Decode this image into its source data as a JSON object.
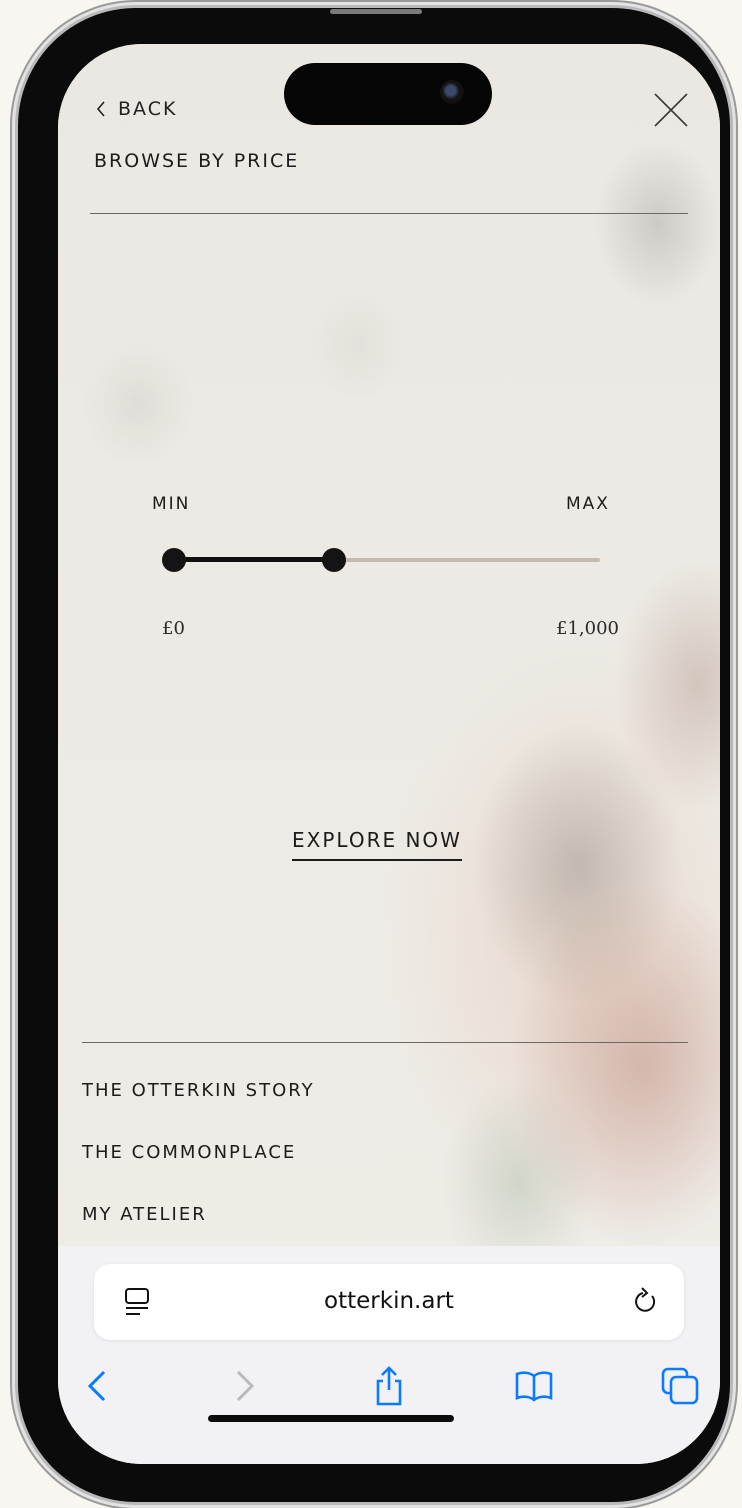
{
  "header": {
    "back_label": "BACK",
    "title": "BROWSE BY PRICE"
  },
  "price_slider": {
    "min_label": "MIN",
    "max_label": "MAX",
    "min_price": "£0",
    "max_price": "£1,000",
    "range_min": 0,
    "range_max": 1000,
    "selected_low": 0,
    "selected_high": 375
  },
  "cta": {
    "explore_label": "EXPLORE NOW"
  },
  "footer_nav": {
    "items": [
      {
        "label": "THE OTTERKIN STORY"
      },
      {
        "label": "THE COMMONPLACE"
      },
      {
        "label": "MY ATELIER"
      }
    ]
  },
  "browser": {
    "url": "otterkin.art"
  },
  "icons": {
    "back": "chevron-left-icon",
    "close": "close-icon",
    "page_settings": "page-settings-icon",
    "reload": "reload-icon",
    "nav_back": "back-arrow-icon",
    "nav_forward": "forward-arrow-icon",
    "share": "share-icon",
    "bookmarks": "book-icon",
    "tabs": "tabs-icon"
  },
  "colors": {
    "ios_blue": "#0a7aff",
    "text": "#1c1c1c",
    "slider_fill": "#111111",
    "slider_track": "#c4baad"
  }
}
